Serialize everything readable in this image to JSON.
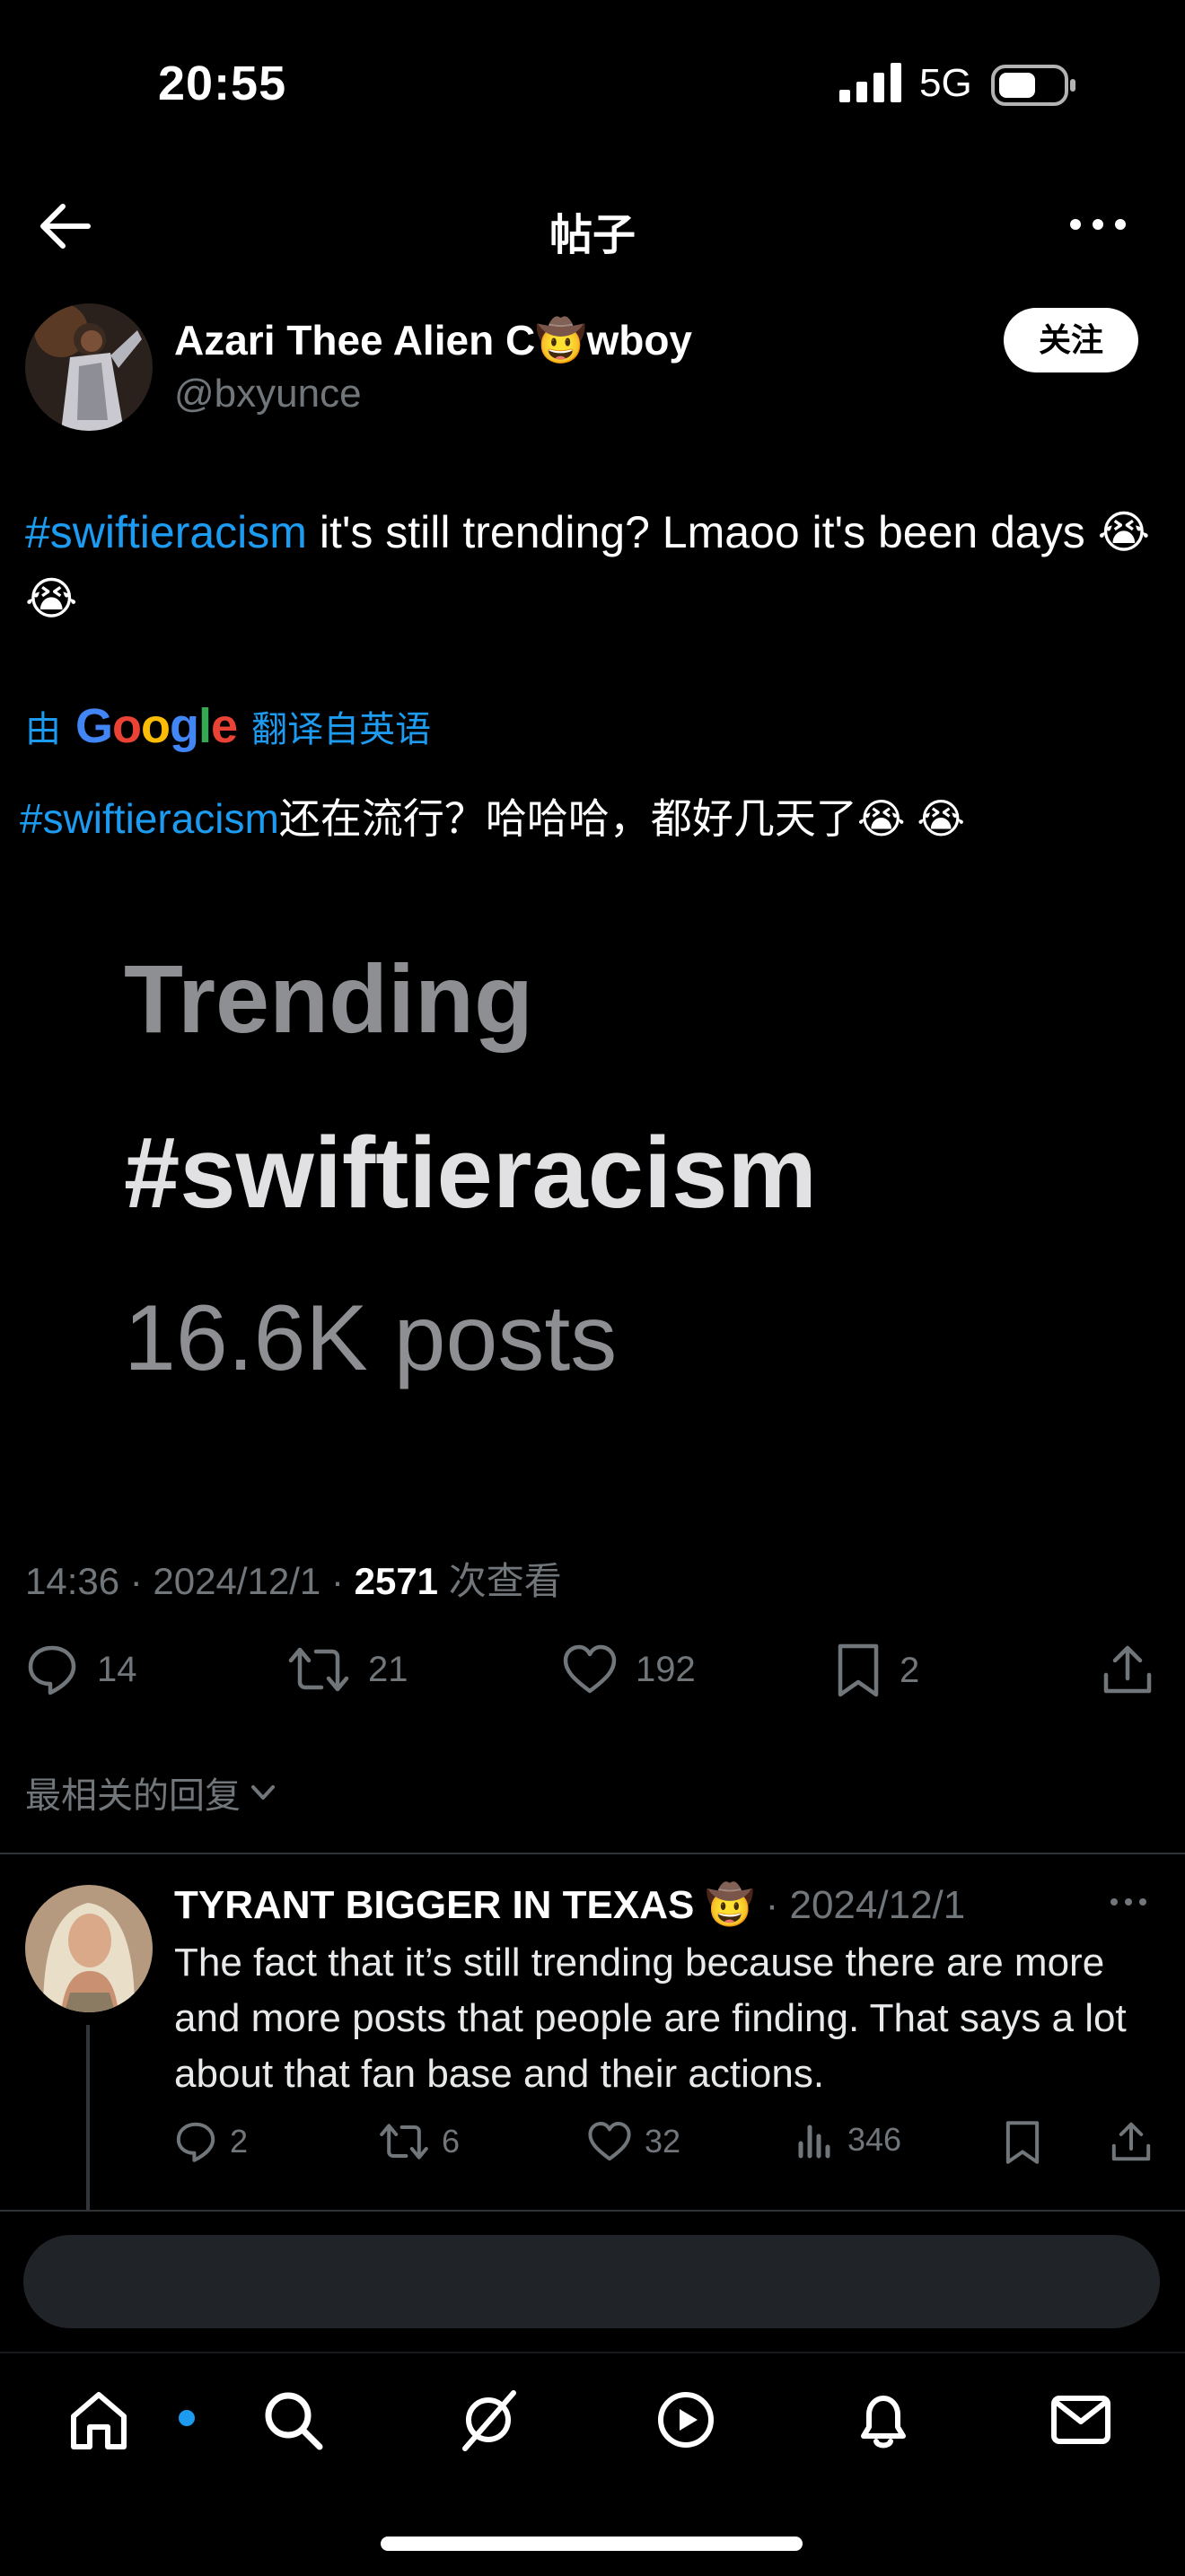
{
  "status_bar": {
    "time": "20:55",
    "network": "5G"
  },
  "header": {
    "title": "帖子"
  },
  "post": {
    "author_name": "Azari Thee Alien C🤠wboy",
    "author_handle": "@bxyunce",
    "follow_label": "关注",
    "text_hashtag": "#swiftieracism",
    "text_body": " it's still trending? Lmaoo it's been days 😭 😭",
    "translation_by": "由",
    "translation_brand": "Google",
    "translation_label": "翻译自英语",
    "translated_hashtag": "#swiftieracism",
    "translated_body": "还在流行？哈哈哈，都好几天了😭 😭",
    "media": {
      "label": "Trending",
      "hashtag": "#swiftieracism",
      "count": "16.6K posts"
    },
    "meta_time": "14:36 · 2024/12/1 · ",
    "meta_views": "2571",
    "meta_views_label": " 次查看",
    "stats": {
      "replies": "14",
      "reposts": "21",
      "likes": "192",
      "bookmarks": "2"
    }
  },
  "replies_sort": {
    "label": "最相关的回复"
  },
  "reply": {
    "author_name": "TYRANT BIGGER IN TEXAS 🤠",
    "date": " · 2024/12/1",
    "text": "The fact that it’s still trending because there are more and more posts that people are finding. That says a lot about that fan base and their actions.",
    "stats": {
      "replies": "2",
      "reposts": "6",
      "likes": "32",
      "views": "346"
    }
  },
  "tabs": [
    "home-icon",
    "search-icon",
    "grok-icon",
    "video-icon",
    "notifications-icon",
    "messages-icon"
  ],
  "colors": {
    "accent": "#1d9bf0",
    "background": "#000000",
    "muted": "#71767b"
  }
}
